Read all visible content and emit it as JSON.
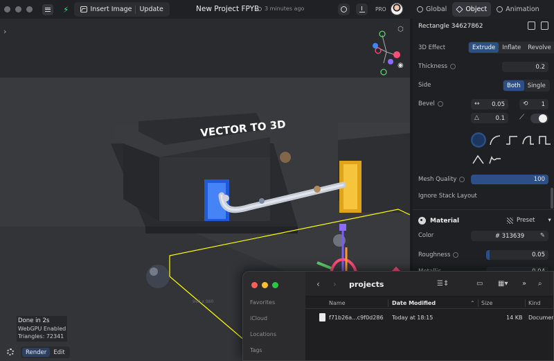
{
  "topbar": {
    "insert_image_label": "Insert Image",
    "update_label": "Update",
    "title": "New Project FPYB",
    "saved_text": "3 minutes ago",
    "pro_label": "PRO"
  },
  "tabs": [
    {
      "label": "Global"
    },
    {
      "label": "Object"
    },
    {
      "label": "Animation"
    }
  ],
  "panel": {
    "object_name": "Rectangle 34627862",
    "effect_label": "3D Effect",
    "effect_options": [
      "Extrude",
      "Inflate",
      "Revolve"
    ],
    "thickness_label": "Thickness",
    "thickness_value": "0.2",
    "side_label": "Side",
    "side_options": [
      "Both",
      "Single"
    ],
    "bevel_label": "Bevel",
    "bevel_size": "0.05",
    "bevel_segments": "1",
    "bevel_angle": "0.1",
    "mesh_quality_label": "Mesh Quality",
    "mesh_quality_value": "100",
    "mesh_quality_fraction": 1.0,
    "ignore_stack_label": "Ignore Stack Layout",
    "material_label": "Material",
    "preset_label": "Preset",
    "color_label": "Color",
    "color_value": "# 313639",
    "roughness_label": "Roughness",
    "roughness_value": "0.05",
    "roughness_fraction": 0.05,
    "metallic_label": "Metallic",
    "metallic_value": "0.04"
  },
  "viewport": {
    "scene_text": "VECTOR TO 3D",
    "stats": [
      "Done in 2s",
      "WebGPU Enabled",
      "Triangles: 72341"
    ],
    "modes": [
      "Render",
      "Edit"
    ],
    "dims_text": "980 x 980"
  },
  "finder": {
    "title": "projects",
    "sidebar": [
      "Favorites",
      "iCloud",
      "Locations",
      "Tags"
    ],
    "columns": [
      "Name",
      "Date Modified",
      "Size",
      "Kind"
    ],
    "rows": [
      {
        "name": "f71b26a...c9f0d286",
        "date": "Today at 18:15",
        "size": "14 KB",
        "kind": "Document"
      }
    ]
  },
  "colors": {
    "accent": "#2b4f86",
    "selection_outline": "#ffff00",
    "brand_green": "#37d67a"
  }
}
